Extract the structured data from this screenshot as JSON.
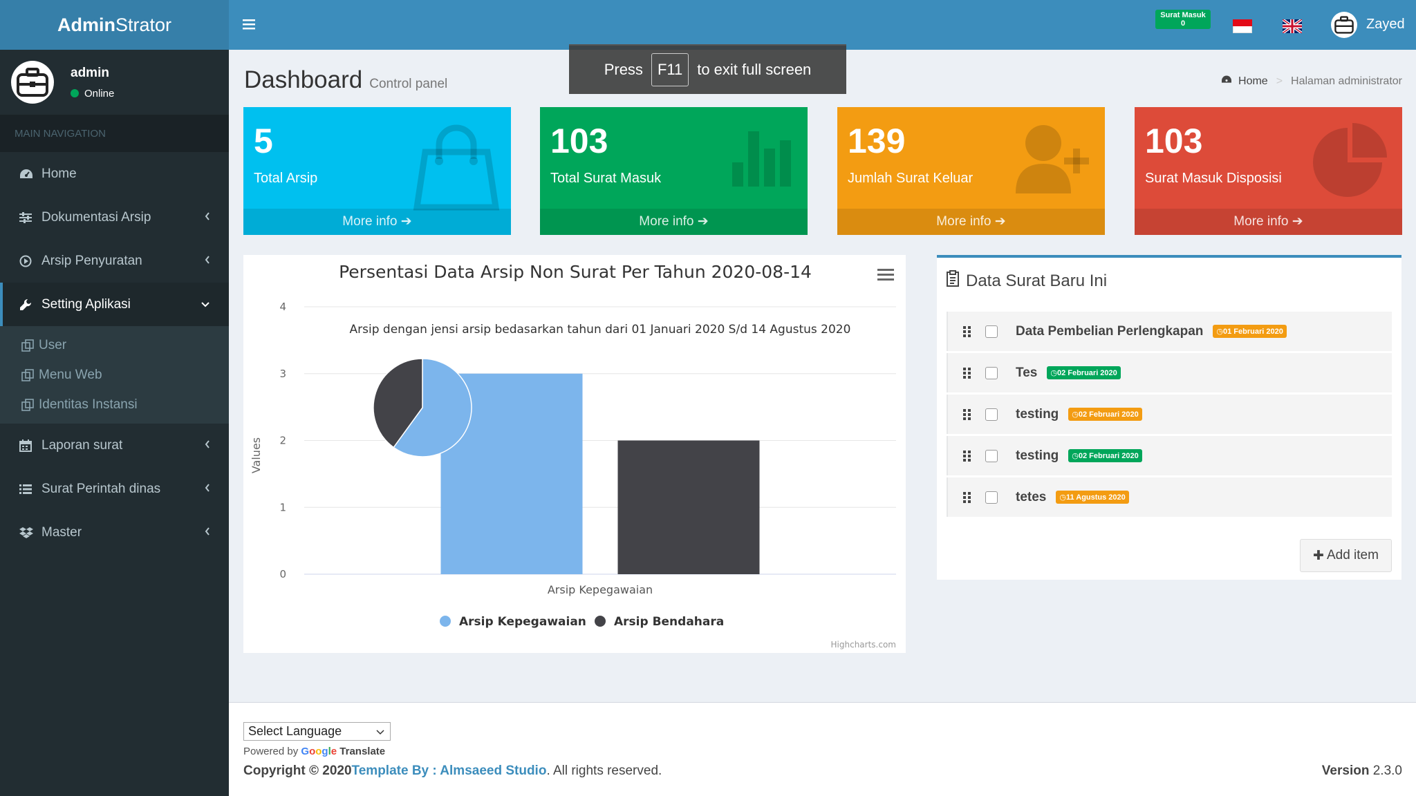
{
  "app": {
    "logo_bold": "Admin",
    "logo_rest": "Strator"
  },
  "sidebar": {
    "user_name": "admin",
    "user_status": "Online",
    "nav_header": "MAIN NAVIGATION",
    "items": [
      {
        "label": "Home",
        "icon": "dashboard-icon"
      },
      {
        "label": "Dokumentasi Arsip",
        "icon": "sliders-icon"
      },
      {
        "label": "Arsip Penyuratan",
        "icon": "play-circle-icon"
      },
      {
        "label": "Setting Aplikasi",
        "icon": "wrench-icon"
      },
      {
        "label": "Laporan surat",
        "icon": "calendar-icon"
      },
      {
        "label": "Surat Perintah dinas",
        "icon": "list-icon"
      },
      {
        "label": "Master",
        "icon": "dropbox-icon"
      }
    ],
    "submenu": [
      "User",
      "Menu Web",
      "Identitas Instansi"
    ]
  },
  "topbar": {
    "mail_badge_label": "Surat Masuk",
    "mail_badge_count": "0",
    "user_name": "Zayed"
  },
  "overlay": {
    "press": "Press",
    "key": "F11",
    "rest": "to exit full screen"
  },
  "header": {
    "title": "Dashboard",
    "subtitle": "Control panel"
  },
  "breadcrumb": {
    "home": "Home",
    "current": "Halaman administrator"
  },
  "boxes": [
    {
      "value": "5",
      "label": "Total Arsip",
      "footer": "More info",
      "color": "#00c0ef"
    },
    {
      "value": "103",
      "label": "Total Surat Masuk",
      "footer": "More info",
      "color": "#00a65a"
    },
    {
      "value": "139",
      "label": "Jumlah Surat Keluar",
      "footer": "More info",
      "color": "#f39c12"
    },
    {
      "value": "103",
      "label": "Surat Masuk Disposisi",
      "footer": "More info",
      "color": "#dd4b39"
    }
  ],
  "chart_data": {
    "type": "bar",
    "title": "Persentasi Data Arsip Non Surat Per Tahun 2020-08-14",
    "subtitle": "Arsip dengan jensi arsip bedasarkan tahun dari 01 Januari 2020 S/d 14 Agustus 2020",
    "categories": [
      "Arsip Kepegawaian"
    ],
    "series": [
      {
        "name": "Arsip Kepegawaian",
        "values": [
          3
        ],
        "color": "#7cb5ec"
      },
      {
        "name": "Arsip Bendahara",
        "values": [
          2
        ],
        "color": "#434348"
      }
    ],
    "pie": [
      {
        "name": "Arsip Kepegawaian",
        "value": 3,
        "color": "#7cb5ec"
      },
      {
        "name": "Arsip Bendahara",
        "value": 2,
        "color": "#434348"
      }
    ],
    "ylabel": "Values",
    "ylim": [
      0,
      4
    ],
    "yticks": [
      "0",
      "1",
      "2",
      "3",
      "4"
    ],
    "legend": "bottom",
    "credits": "Highcharts.com"
  },
  "todo": {
    "title": "Data Surat Baru Ini",
    "items": [
      {
        "text": "Data Pembelian Perlengkapan",
        "date": "01 Februari 2020",
        "color": "#f39c12"
      },
      {
        "text": "Tes",
        "date": "02 Februari 2020",
        "color": "#00a65a"
      },
      {
        "text": "testing",
        "date": "02 Februari 2020",
        "color": "#f39c12"
      },
      {
        "text": "testing",
        "date": "02 Februari 2020",
        "color": "#00a65a"
      },
      {
        "text": "tetes",
        "date": "11 Agustus 2020",
        "color": "#f39c12"
      }
    ],
    "add_label": "Add item"
  },
  "footer": {
    "select_language": "Select Language",
    "powered_by": "Powered by",
    "google": "Google",
    "translate": "Translate",
    "copyright_prefix": "Copyright © 2020",
    "template_by": "Template By : Almsaeed Studio",
    "rights": ". All rights reserved.",
    "version_label": "Version",
    "version": "2.3.0"
  }
}
